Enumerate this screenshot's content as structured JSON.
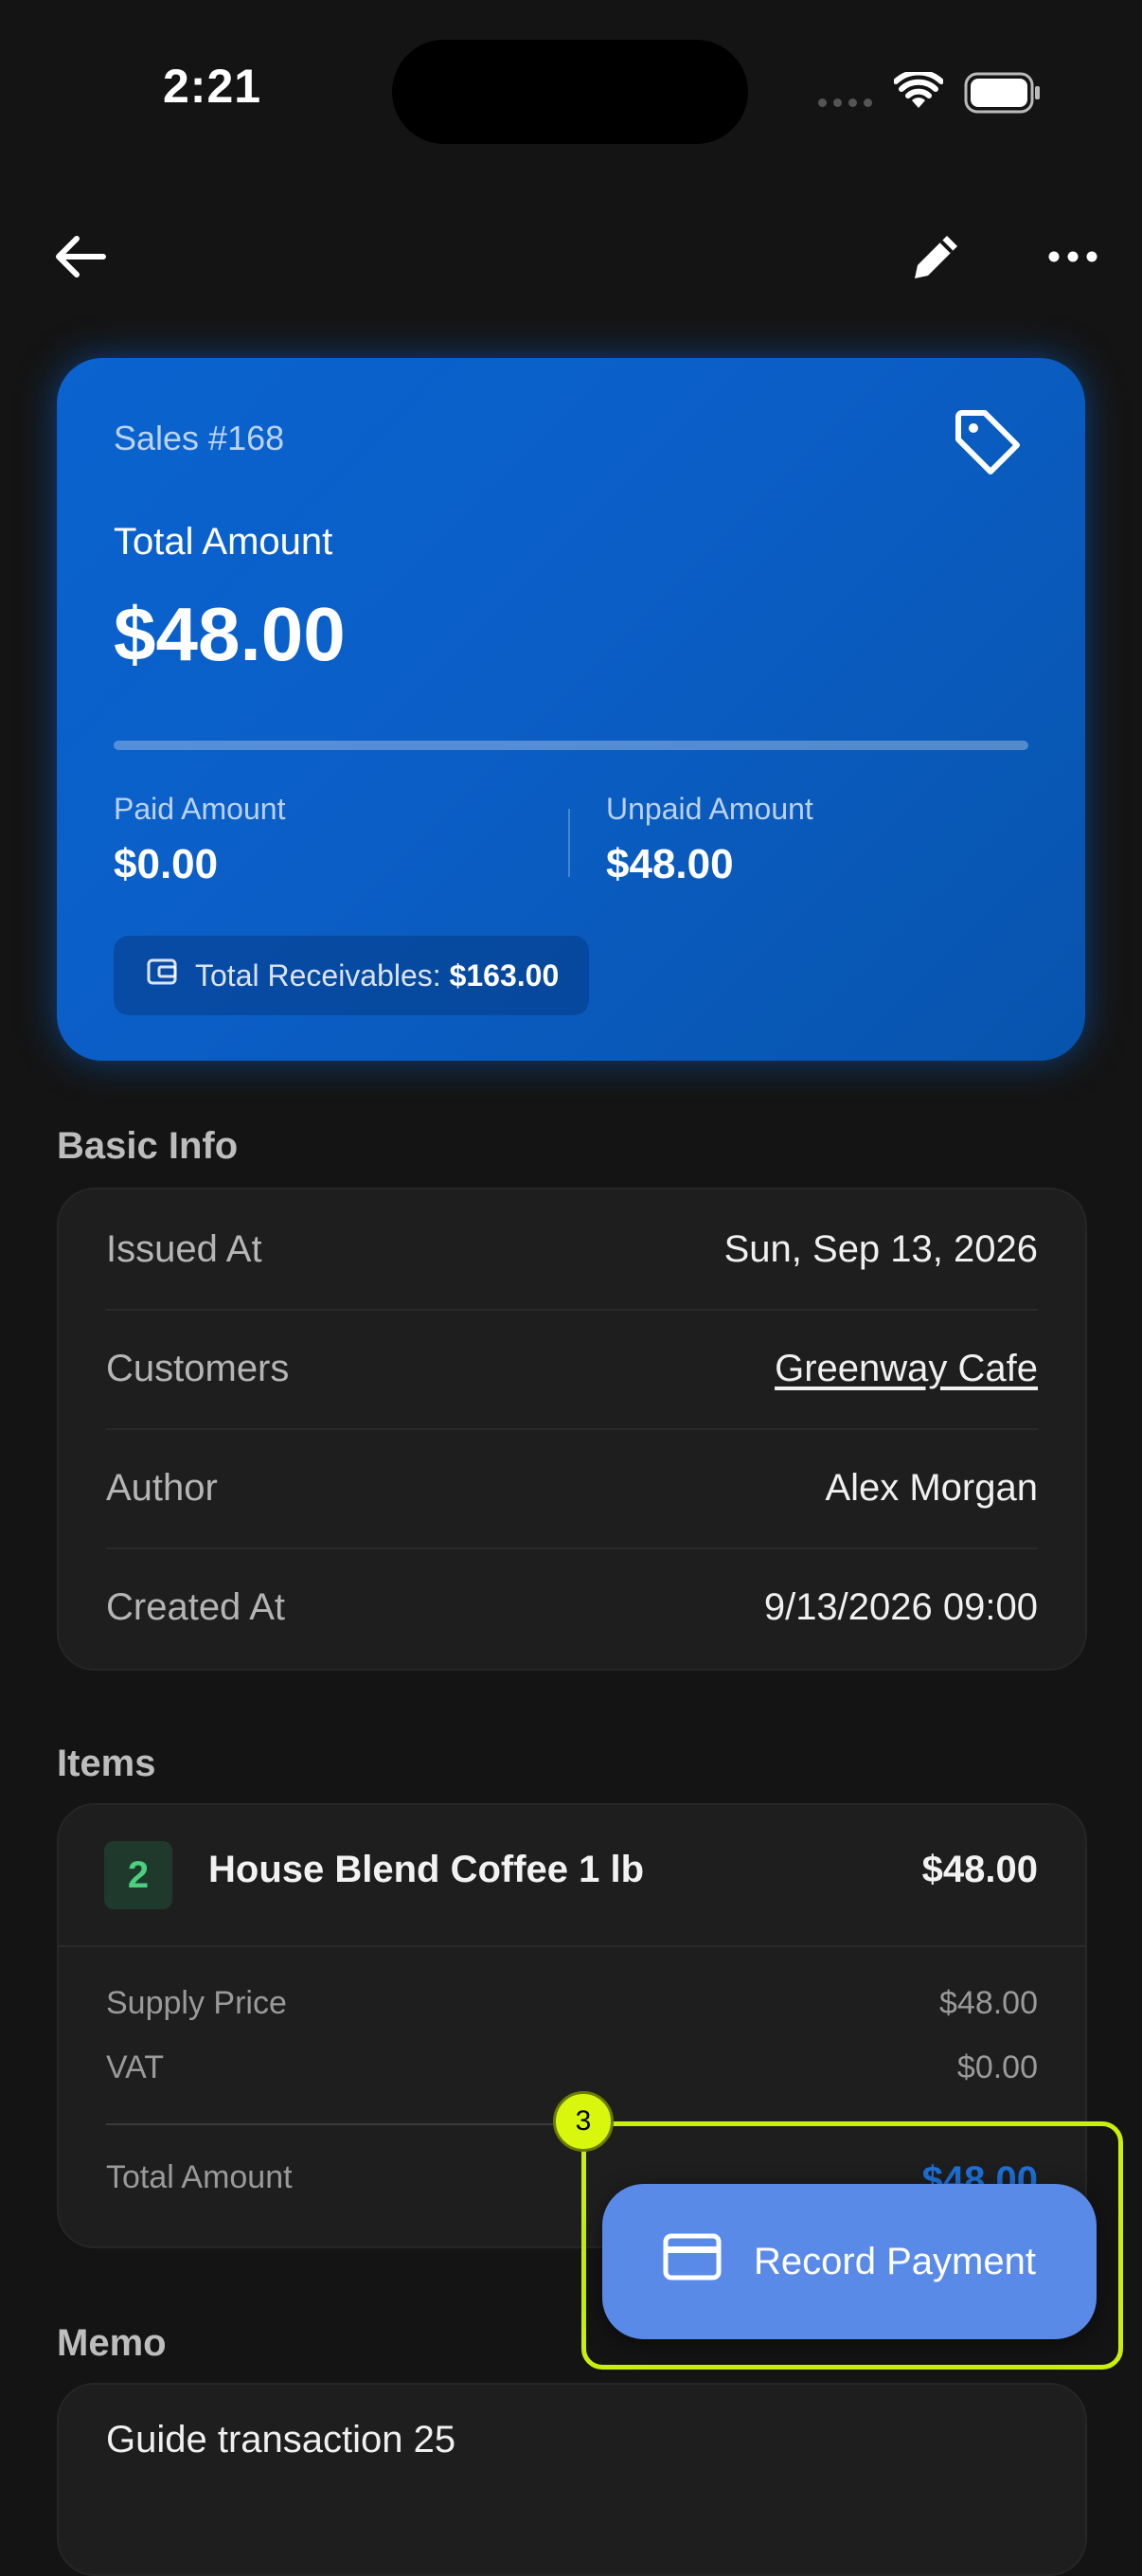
{
  "status_bar": {
    "time": "2:21"
  },
  "summary": {
    "sales_number": "Sales #168",
    "total_label": "Total Amount",
    "total_value": "$48.00",
    "paid_progress": 0.0,
    "paid_label": "Paid Amount",
    "paid_value": "$0.00",
    "unpaid_label": "Unpaid Amount",
    "unpaid_value": "$48.00",
    "receivables_label": "Total Receivables:",
    "receivables_value": "$163.00"
  },
  "basic_info": {
    "title": "Basic Info",
    "rows": [
      {
        "label": "Issued At",
        "value": "Sun, Sep 13, 2026"
      },
      {
        "label": "Customers",
        "value": "Greenway Cafe"
      },
      {
        "label": "Author",
        "value": "Alex Morgan"
      },
      {
        "label": "Created At",
        "value": "9/13/2026 09:00"
      }
    ]
  },
  "items": {
    "title": "Items",
    "list": [
      {
        "qty": "2",
        "name": "House Blend Coffee 1 lb",
        "amount": "$48.00",
        "supply_label": "Supply Price",
        "supply_value": "$48.00",
        "vat_label": "VAT",
        "vat_value": "$0.00",
        "total_label": "Total Amount",
        "total_value": "$48.00"
      }
    ]
  },
  "memo": {
    "title": "Memo",
    "text": "Guide transaction 25"
  },
  "actions": {
    "record_payment": "Record Payment",
    "step_badge": "3"
  },
  "colors": {
    "accent": "#0a63cf",
    "link": "#5c8df2",
    "button": "#5a8ae8",
    "highlight": "#c8f00c"
  }
}
